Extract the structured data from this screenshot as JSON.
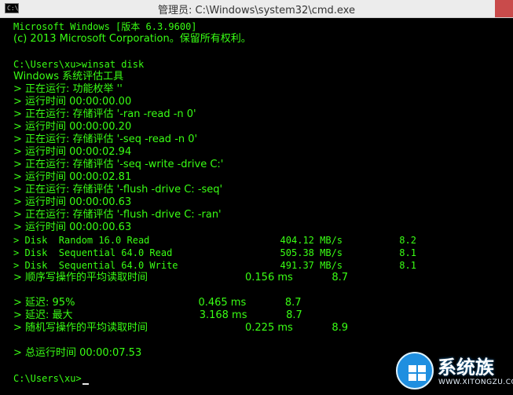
{
  "window": {
    "title": "管理员: C:\\Windows\\system32\\cmd.exe",
    "icon_label": "C:\\"
  },
  "console_lines": [
    "Microsoft Windows [版本 6.3.9600]",
    "(c) 2013 Microsoft Corporation。保留所有权利。",
    "",
    "C:\\Users\\xu>winsat disk",
    "Windows 系统评估工具",
    "> 正在运行: 功能枚举 ''",
    "> 运行时间 00:00:00.00",
    "> 正在运行: 存储评估 '-ran -read -n 0'",
    "> 运行时间 00:00:00.20",
    "> 正在运行: 存储评估 '-seq -read -n 0'",
    "> 运行时间 00:00:02.94",
    "> 正在运行: 存储评估 '-seq -write -drive C:'",
    "> 运行时间 00:00:02.81",
    "> 正在运行: 存储评估 '-flush -drive C: -seq'",
    "> 运行时间 00:00:00.63",
    "> 正在运行: 存储评估 '-flush -drive C: -ran'",
    "> 运行时间 00:00:00.63",
    "> Disk  Random 16.0 Read                       404.12 MB/s          8.2",
    "> Disk  Sequential 64.0 Read                   505.38 MB/s          8.1",
    "> Disk  Sequential 64.0 Write                  491.37 MB/s          8.1",
    "> 顺序写操作的平均读取时间                              0.156 ms            8.7",
    "",
    "> 延迟: 95%                                      0.465 ms            8.7",
    "> 延迟: 最大                                       3.168 ms            8.7",
    "> 随机写操作的平均读取时间                              0.225 ms            8.9",
    "",
    "> 总运行时间 00:00:07.53",
    "",
    "C:\\Users\\xu>"
  ],
  "watermark": {
    "text": "系统族",
    "url": "WWW.XITONGZU.COM"
  },
  "colors": {
    "console_text": "#39ff14",
    "console_bg": "#000000",
    "titlebar_bg": "#ececec"
  }
}
